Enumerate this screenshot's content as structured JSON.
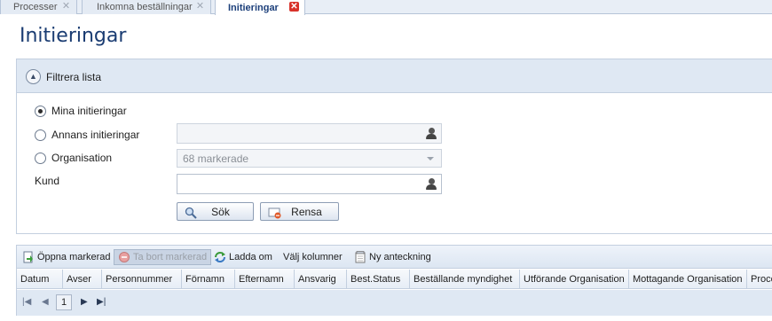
{
  "tabs": [
    {
      "label": "Processer",
      "active": false
    },
    {
      "label": "Inkomna beställningar",
      "active": false
    },
    {
      "label": "Initieringar",
      "active": true
    }
  ],
  "page_title": "Initieringar",
  "filter": {
    "title": "Filtrera lista",
    "options": [
      {
        "label": "Mina initieringar",
        "checked": true
      },
      {
        "label": "Annans initieringar",
        "checked": false
      },
      {
        "label": "Organisation",
        "checked": false
      }
    ],
    "kund_label": "Kund",
    "annans_value": "",
    "organisation_value": "68 markerade",
    "kund_value": "",
    "search_button": "Sök",
    "clear_button": "Rensa"
  },
  "toolbar": {
    "open_selected": "Öppna markerad",
    "remove_selected": "Ta bort markerad",
    "reload": "Ladda om",
    "choose_columns": "Välj kolumner",
    "new_note": "Ny anteckning"
  },
  "columns": [
    "Datum",
    "Avser",
    "Personnummer",
    "Förnamn",
    "Efternamn",
    "Ansvarig",
    "Best.Status",
    "Beställande myndighet",
    "Utförande Organisation",
    "Mottagande Organisation",
    "Proce"
  ],
  "pager": {
    "current_page": "1"
  },
  "colors": {
    "accent": "#1a3c72",
    "panel_header": "#dfe8f3",
    "close_active": "#d8322a"
  }
}
